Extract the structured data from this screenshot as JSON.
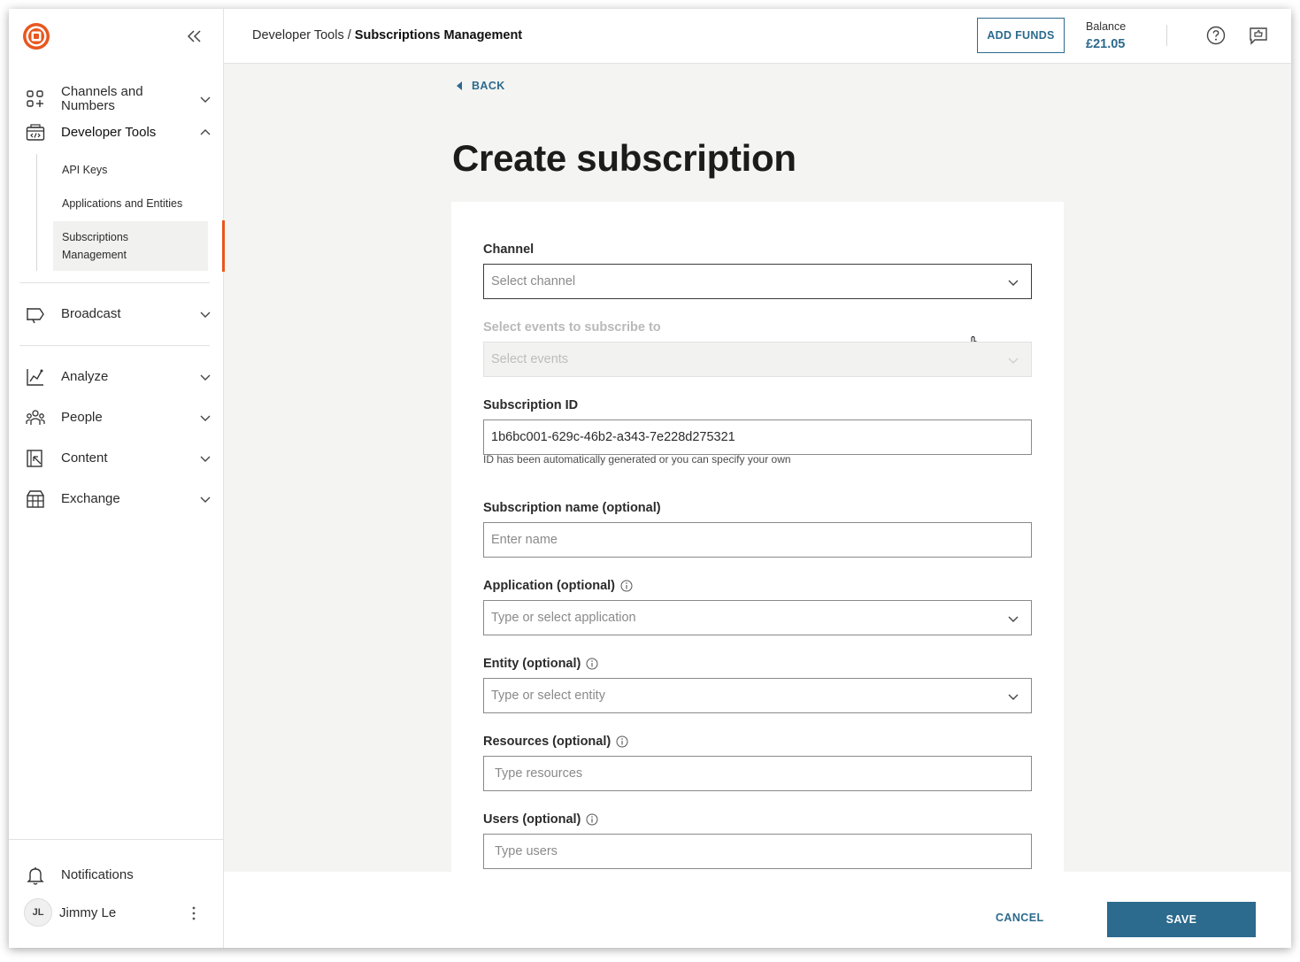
{
  "sidebar": {
    "nav": [
      {
        "label": "Channels and Numbers",
        "icon": "grid-plus-icon",
        "expanded": false
      },
      {
        "label": "Developer Tools",
        "icon": "code-window-icon",
        "expanded": true
      },
      {
        "label": "Broadcast",
        "icon": "megaphone-icon",
        "expanded": false
      },
      {
        "label": "Analyze",
        "icon": "chart-icon",
        "expanded": false
      },
      {
        "label": "People",
        "icon": "people-icon",
        "expanded": false
      },
      {
        "label": "Content",
        "icon": "content-icon",
        "expanded": false
      },
      {
        "label": "Exchange",
        "icon": "exchange-icon",
        "expanded": false
      }
    ],
    "dev_tools_sub": [
      {
        "label": "API Keys"
      },
      {
        "label": "Applications and Entities"
      },
      {
        "label": "Subscriptions Management",
        "selected": true
      }
    ],
    "notifications_label": "Notifications",
    "user": {
      "initials": "JL",
      "name": "Jimmy Le"
    }
  },
  "header": {
    "breadcrumb_parent": "Developer Tools / ",
    "breadcrumb_current": "Subscriptions Management",
    "add_funds_label": "ADD FUNDS",
    "balance_label": "Balance",
    "balance_value": "£21.05"
  },
  "main": {
    "back_label": "BACK",
    "title": "Create subscription",
    "form": {
      "channel": {
        "label": "Channel",
        "placeholder": "Select channel"
      },
      "events": {
        "label": "Select events to subscribe to",
        "placeholder": "Select events",
        "disabled": true
      },
      "subscription_id": {
        "label": "Subscription ID",
        "value": "1b6bc001-629c-46b2-a343-7e228d275321",
        "helper": "ID has been automatically generated or you can specify your own"
      },
      "subscription_name": {
        "label": "Subscription name (optional)",
        "placeholder": "Enter name"
      },
      "application": {
        "label": "Application (optional)",
        "placeholder": "Type or select application"
      },
      "entity": {
        "label": "Entity (optional)",
        "placeholder": "Type or select entity"
      },
      "resources": {
        "label": "Resources (optional)",
        "placeholder": "Type resources"
      },
      "users": {
        "label": "Users (optional)",
        "placeholder": "Type users"
      }
    }
  },
  "footer": {
    "cancel_label": "CANCEL",
    "save_label": "SAVE"
  },
  "colors": {
    "accent": "#2c6a8e",
    "brand": "#e8571e",
    "background": "#f4f4f2"
  }
}
